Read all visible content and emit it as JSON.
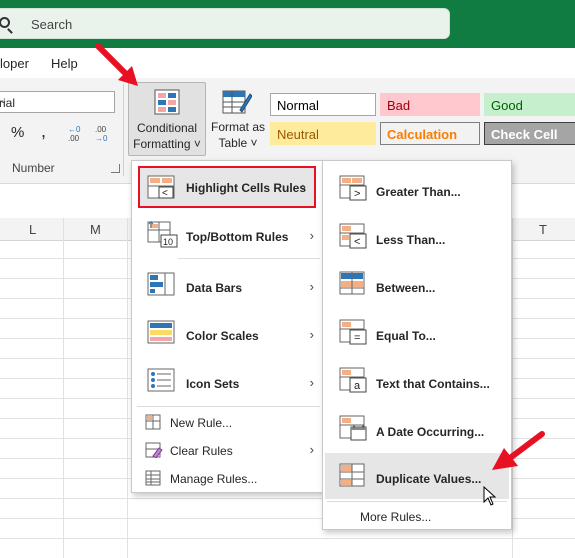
{
  "search": {
    "placeholder": "Search"
  },
  "tabs": [
    "loper",
    "Help"
  ],
  "ribbon": {
    "font_name": "rial",
    "number_group_label": "Number",
    "percent_symbol": "%",
    "comma_symbol": ",",
    "cf_button": {
      "line1": "Conditional",
      "line2": "Formatting ˅"
    },
    "fat_button": {
      "line1": "Format as",
      "line2": "Table ˅"
    }
  },
  "cell_styles": [
    {
      "label": "Normal",
      "bg": "#ffffff",
      "fg": "#000000",
      "border": "#a6a6a6"
    },
    {
      "label": "Bad",
      "bg": "#ffc7ce",
      "fg": "#9c0006",
      "border": "#ffc7ce"
    },
    {
      "label": "Good",
      "bg": "#c6efce",
      "fg": "#006100",
      "border": "#c6efce"
    },
    {
      "label": "Neutral",
      "bg": "#ffeb9c",
      "fg": "#9c5700",
      "border": "#ffeb9c"
    },
    {
      "label": "Calculation",
      "bg": "#f2f2f2",
      "fg": "#fa7d00",
      "border": "#7f7f7f"
    },
    {
      "label": "Check Cell",
      "bg": "#a5a5a5",
      "fg": "#ffffff",
      "border": "#3f3f3f"
    }
  ],
  "columns": [
    "L",
    "M",
    "T"
  ],
  "cf_menu": {
    "items": [
      {
        "label": "Highlight Cells Rules",
        "has_submenu": true,
        "icon": "highlight-cells-icon"
      },
      {
        "label": "Top/Bottom Rules",
        "has_submenu": true,
        "icon": "top-bottom-icon"
      },
      {
        "label": "Data Bars",
        "has_submenu": true,
        "icon": "data-bars-icon"
      },
      {
        "label": "Color Scales",
        "has_submenu": true,
        "icon": "color-scales-icon"
      },
      {
        "label": "Icon Sets",
        "has_submenu": true,
        "icon": "icon-sets-icon"
      }
    ],
    "small_items": [
      {
        "label": "New Rule...",
        "icon": "new-rule-icon",
        "has_submenu": false
      },
      {
        "label": "Clear Rules",
        "icon": "clear-rules-icon",
        "has_submenu": true
      },
      {
        "label": "Manage Rules...",
        "icon": "manage-rules-icon",
        "has_submenu": false
      }
    ]
  },
  "highlight_submenu": {
    "items": [
      {
        "label": "Greater Than...",
        "icon": "greater-than-icon"
      },
      {
        "label": "Less Than...",
        "icon": "less-than-icon"
      },
      {
        "label": "Between...",
        "icon": "between-icon"
      },
      {
        "label": "Equal To...",
        "icon": "equal-to-icon"
      },
      {
        "label": "Text that Contains...",
        "icon": "text-contains-icon"
      },
      {
        "label": "A Date Occurring...",
        "icon": "date-occurring-icon"
      },
      {
        "label": "Duplicate Values...",
        "icon": "duplicate-values-icon"
      }
    ],
    "more_rules": "More Rules..."
  },
  "colors": {
    "excel_green": "#107c41",
    "annotation_red": "#e81123",
    "accent_blue": "#2e75b6",
    "accent_orange": "#f4b084",
    "accent_red": "#f4a6a6"
  }
}
